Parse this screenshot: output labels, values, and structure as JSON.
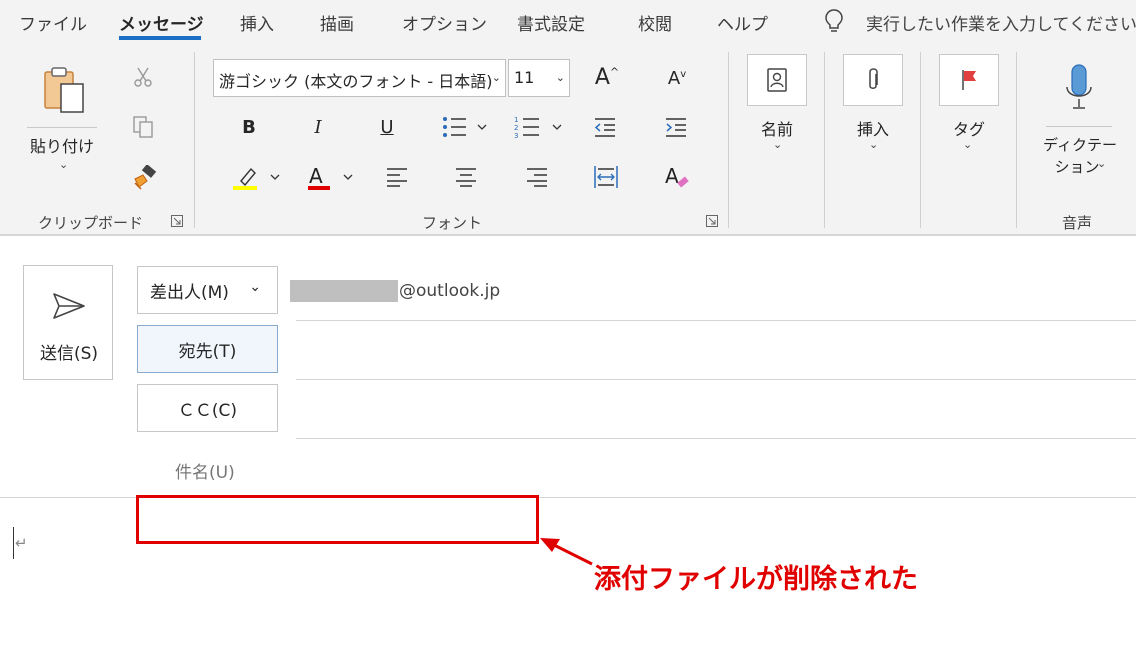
{
  "menu": {
    "tabs": [
      {
        "label": "ファイル"
      },
      {
        "label": "メッセージ"
      },
      {
        "label": "挿入"
      },
      {
        "label": "描画"
      },
      {
        "label": "オプション"
      },
      {
        "label": "書式設定"
      },
      {
        "label": "校閲"
      },
      {
        "label": "ヘルプ"
      }
    ],
    "active_tab": "メッセージ",
    "tell_me": "実行したい作業を入力してください"
  },
  "ribbon": {
    "clipboard": {
      "label": "クリップボード",
      "paste_label": "貼り付け",
      "icons": [
        "clipboard-paste-icon",
        "scissors-icon",
        "copy-icon",
        "format-painter-icon"
      ]
    },
    "font": {
      "label": "フォント",
      "font_name": "游ゴシック (本文のフォント - 日本語)",
      "font_size": "11",
      "bold": "B",
      "italic": "I",
      "underline": "U",
      "highlight_color": "#ffff00",
      "font_color": "#e00000"
    },
    "names": {
      "label": "名前"
    },
    "insert": {
      "label": "挿入"
    },
    "tags": {
      "label": "タグ"
    },
    "voice": {
      "label": "音声",
      "dictate_line1": "ディクテー",
      "dictate_line2": "ション"
    }
  },
  "compose": {
    "send_label": "送信(S)",
    "from_label": "差出人(M)",
    "from_address": "@outlook.jp",
    "to_label": "宛先(T)",
    "cc_label": "ＣＣ(C)",
    "subject_label": "件名(U)",
    "body_mark": "↵"
  },
  "annotation": {
    "callout": "添付ファイルが削除された",
    "color": "#e00000"
  }
}
